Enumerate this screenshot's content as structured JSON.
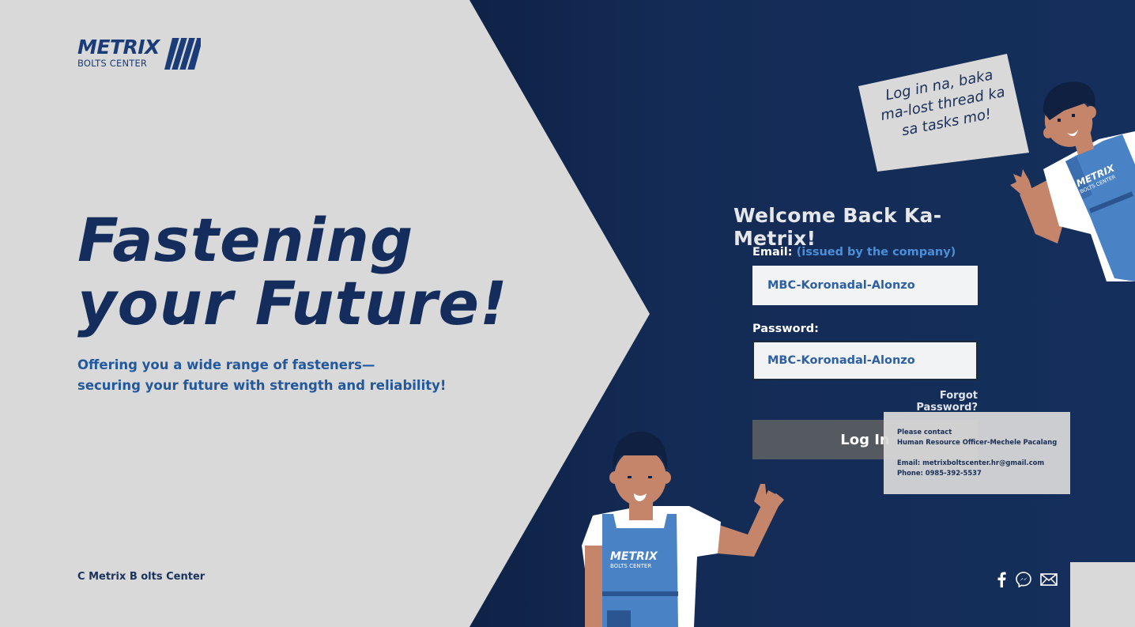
{
  "brand": {
    "wordmark": "METRIX",
    "sub": "BOLTS CENTER"
  },
  "hero": {
    "title_line1": "Fastening",
    "title_line2": "your Future!",
    "subtitle_line1": "Offering you a wide range of fasteners—",
    "subtitle_line2": "securing your future with strength and reliability!"
  },
  "footer": {
    "copyright": "C Metrix B olts Center"
  },
  "speech": {
    "line1": "Log in na, baka",
    "line2": "ma-lost thread ka",
    "line3": "sa tasks mo!"
  },
  "form": {
    "welcome": "Welcome Back Ka-Metrix!",
    "email_label": "Email:",
    "email_hint": "(issued by the company)",
    "email_value": "MBC-Koronadal-Alonzo",
    "password_label": "Password:",
    "password_value": "MBC-Koronadal-Alonzo",
    "forgot": "Forgot Password?",
    "login": "Log In"
  },
  "tooltip": {
    "line1": "Please contact",
    "line2": "Human Resource Officer-Mechele Pacalang",
    "email": "Email: metrixboltscenter.hr@gmail.com",
    "phone": "Phone: 0985-392-5537"
  },
  "mascot_shirt": {
    "wordmark": "METRIX",
    "sub": "BOLTS CENTER"
  },
  "social": [
    "facebook-icon",
    "messenger-icon",
    "mail-icon"
  ],
  "colors": {
    "navy": "#142d5c",
    "light_bg": "#d9d9d9",
    "accent_blue": "#4a8fd9",
    "button": "#545a60"
  }
}
